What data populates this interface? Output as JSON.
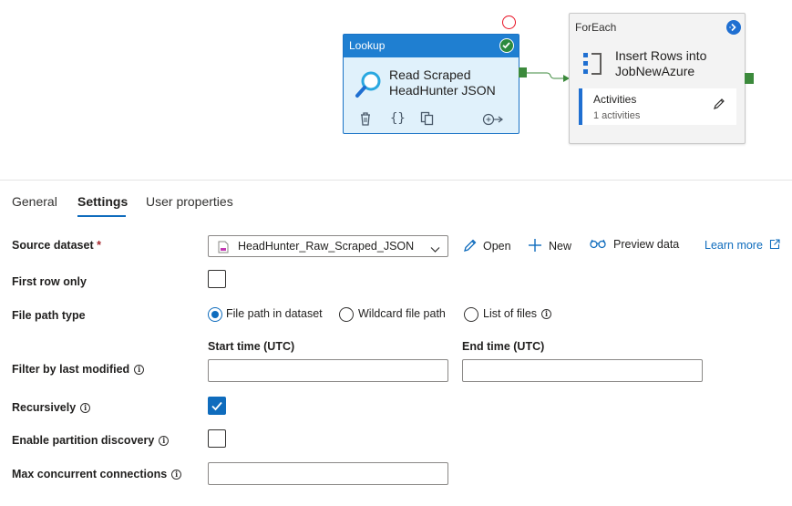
{
  "pipeline": {
    "lookup": {
      "type_label": "Lookup",
      "title_line1": "Read Scraped",
      "title_line2": "HeadHunter JSON"
    },
    "foreach": {
      "type_label": "ForEach",
      "title_line1": "Insert Rows into",
      "title_line2": "JobNewAzure",
      "activities_label": "Activities",
      "activities_count": "1 activities"
    }
  },
  "tabs": [
    {
      "label": "General",
      "active": false
    },
    {
      "label": "Settings",
      "active": true
    },
    {
      "label": "User properties",
      "active": false
    }
  ],
  "form": {
    "source_dataset": {
      "label": "Source dataset",
      "required_mark": "*",
      "value": "HeadHunter_Raw_Scraped_JSON",
      "open_label": "Open",
      "new_label": "New",
      "preview_label": "Preview data",
      "learn_more_label": "Learn more"
    },
    "first_row_only": {
      "label": "First row only",
      "checked": false
    },
    "file_path_type": {
      "label": "File path type",
      "options": [
        "File path in dataset",
        "Wildcard file path",
        "List of files"
      ],
      "selected": "File path in dataset"
    },
    "filter_by_last_modified": {
      "label": "Filter by last modified",
      "start_label": "Start time (UTC)",
      "end_label": "End time (UTC)",
      "start_value": "",
      "end_value": ""
    },
    "recursively": {
      "label": "Recursively",
      "checked": true
    },
    "enable_partition_discovery": {
      "label": "Enable partition discovery",
      "checked": false
    },
    "max_concurrent_connections": {
      "label": "Max concurrent connections",
      "value": ""
    }
  },
  "colors": {
    "accent": "#0f6cbd",
    "lookup_header": "#1f7fd1",
    "success": "#2b8a3e",
    "error_ring": "#e81123",
    "connector": "#3c8a3c"
  }
}
